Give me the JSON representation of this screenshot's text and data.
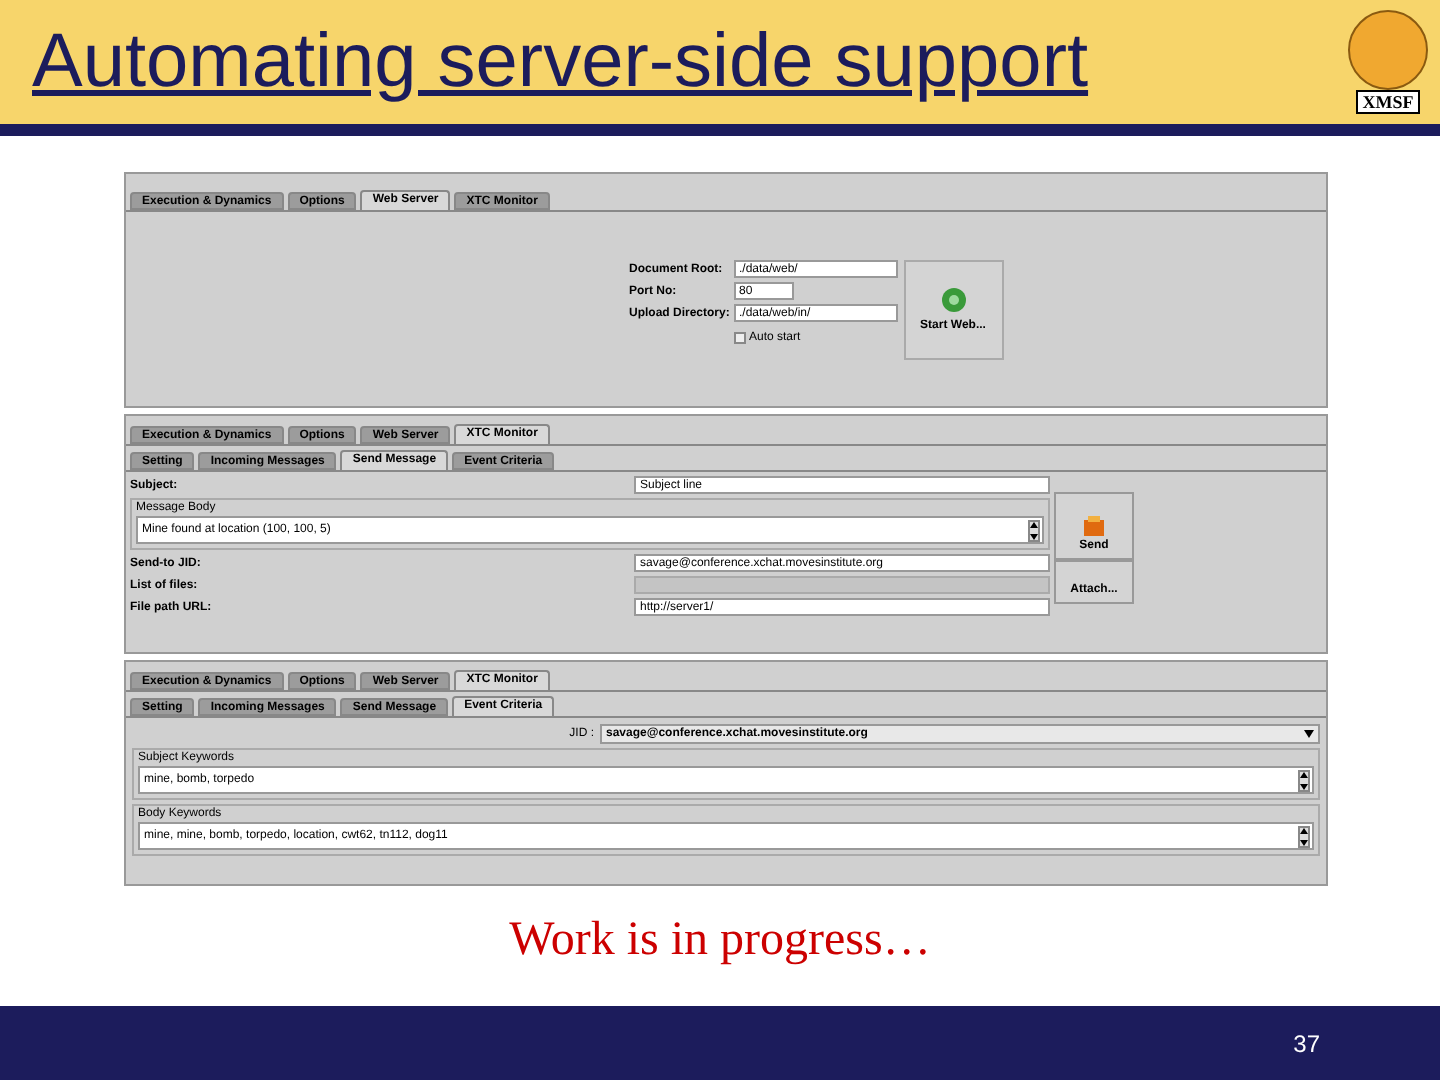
{
  "title": "Automating server-side support",
  "logo_text": "XMSF",
  "web_server_panel": {
    "tabs": [
      {
        "label": "Execution & Dynamics",
        "selected": false
      },
      {
        "label": "Options",
        "selected": false
      },
      {
        "label": "Web Server",
        "selected": true
      },
      {
        "label": "XTC Monitor",
        "selected": false
      }
    ],
    "fields": [
      {
        "label": "Document Root:",
        "value": "./data/web/"
      },
      {
        "label": "Port No:",
        "value": "80"
      },
      {
        "label": "Upload Directory:",
        "value": "./data/web/in/"
      }
    ],
    "checkbox": {
      "label": "Auto start",
      "checked": false
    },
    "button": "Start Web..."
  },
  "send_message_panel": {
    "tabs": [
      {
        "label": "Execution & Dynamics",
        "selected": false
      },
      {
        "label": "Options",
        "selected": false
      },
      {
        "label": "Web Server",
        "selected": false
      },
      {
        "label": "XTC Monitor",
        "selected": true
      }
    ],
    "subtabs": [
      {
        "label": "Setting",
        "selected": false
      },
      {
        "label": "Incoming Messages",
        "selected": false
      },
      {
        "label": "Send Message",
        "selected": true
      },
      {
        "label": "Event Criteria",
        "selected": false
      }
    ],
    "subject": {
      "label": "Subject:",
      "value": "Subject line"
    },
    "message_body": {
      "label": "Message Body",
      "value": "Mine found at location (100, 100, 5)"
    },
    "send_to": {
      "label": "Send-to JID:",
      "value": "savage@conference.xchat.movesinstitute.org"
    },
    "list_of_files": {
      "label": "List of files:"
    },
    "file_path": {
      "label": "File path URL:",
      "value": "http://server1/"
    },
    "buttons": [
      "Send",
      "Attach..."
    ]
  },
  "event_criteria_panel": {
    "tabs": [
      {
        "label": "Execution & Dynamics",
        "selected": false
      },
      {
        "label": "Options",
        "selected": false
      },
      {
        "label": "Web Server",
        "selected": false
      },
      {
        "label": "XTC Monitor",
        "selected": true
      }
    ],
    "subtabs": [
      {
        "label": "Setting",
        "selected": false
      },
      {
        "label": "Incoming Messages",
        "selected": false
      },
      {
        "label": "Send Message",
        "selected": false
      },
      {
        "label": "Event Criteria",
        "selected": true
      }
    ],
    "jid": {
      "label": "JID :",
      "value": "savage@conference.xchat.movesinstitute.org"
    },
    "subject_keywords": {
      "label": "Subject Keywords",
      "value": "mine, bomb, torpedo"
    },
    "body_keywords": {
      "label": "Body Keywords",
      "value": "mine, mine, bomb, torpedo, location, cwt62, tn112, dog11"
    }
  },
  "caption": "Work is in progress…",
  "page_number": "37"
}
